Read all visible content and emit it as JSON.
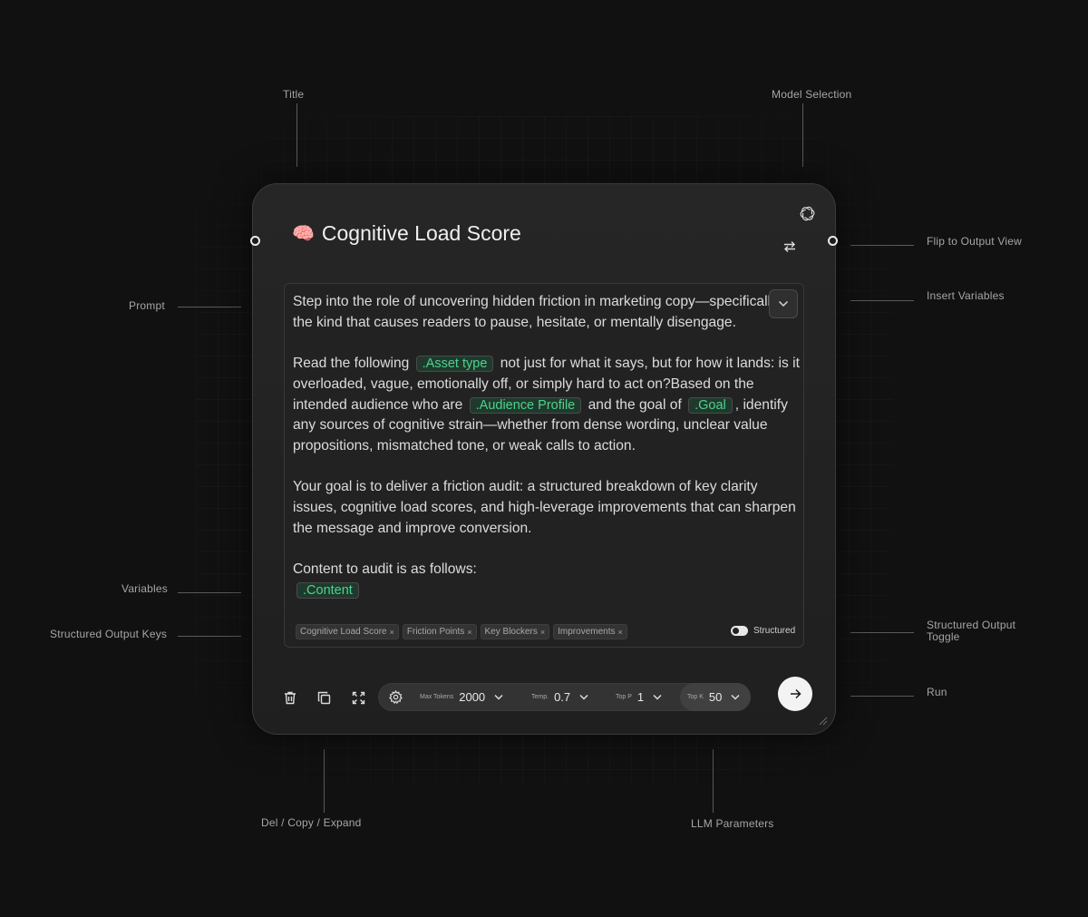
{
  "annotations": {
    "title": "Title",
    "model_selection": "Model Selection",
    "flip_output": "Flip to Output View",
    "prompt": "Prompt",
    "insert_variables": "Insert Variables",
    "variables": "Variables",
    "structured_output_keys": "Structured Output Keys",
    "structured_output_toggle": "Structured Output Toggle",
    "run": "Run",
    "del_copy_expand": "Del / Copy / Expand",
    "llm_parameters": "LLM Parameters"
  },
  "card": {
    "title_emoji": "🧠",
    "title": "Cognitive Load Score",
    "model_icon": "openai-icon",
    "flip_icon": "swap-arrows-icon"
  },
  "prompt": {
    "p1": "Step into the role of uncovering hidden friction in marketing copy—specifically the kind that causes readers to pause, hesitate, or mentally disengage.",
    "p2_a": "Read the following",
    "var_asset": ".Asset type",
    "p2_b": "not just for what it says, but for how it lands: is it overloaded, vague, emotionally off, or simply hard to act on?Based on the intended audience who are",
    "var_audience": ".Audience Profile",
    "p2_c": "and the goal of",
    "var_goal": ".Goal",
    "p2_d": ", identify any sources of cognitive strain—whether from dense wording, unclear value propositions, mismatched tone, or weak calls to action.",
    "p3": "Your goal is to deliver a friction audit: a structured breakdown of key clarity issues, cognitive load scores, and high-leverage improvements that can sharpen the message and improve conversion.",
    "p4": "Content to audit is as follows:",
    "var_content": ".Content"
  },
  "keys": [
    "Cognitive Load Score",
    "Friction Points",
    "Key Blockers",
    "Improvements"
  ],
  "key_remove_glyph": "×",
  "structured": {
    "label": "Structured",
    "on": true
  },
  "params": {
    "max_tokens_label": "Max Tokens",
    "max_tokens": "2000",
    "temp_label": "Temp.",
    "temp": "0.7",
    "top_p_label": "Top P",
    "top_p": "1",
    "top_k_label": "Top K",
    "top_k": "50"
  },
  "colors": {
    "accent_var": "#4fd18f",
    "background": "#111111",
    "card": "#232323"
  }
}
